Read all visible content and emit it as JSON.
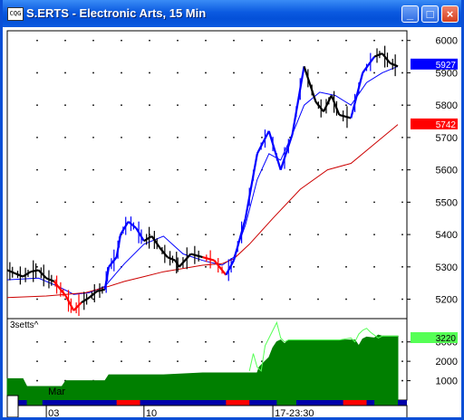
{
  "window": {
    "icon_label": "CQG",
    "title": "S.ERTS - Electronic Arts, 15 Min",
    "buttons": {
      "minimize": "_",
      "maximize": "□",
      "close": "×"
    }
  },
  "colors": {
    "price_up": "#0000ff",
    "price_down": "#ff0000",
    "price_neutral": "#000000",
    "fast_ma": "#0000ff",
    "slow_ma": "#cc0000",
    "volume_fill": "#007f00",
    "volume_line": "#55ff55"
  },
  "chart_data": [
    {
      "type": "line",
      "panel": "price",
      "title": "S.ERTS - Electronic Arts, 15 Min",
      "ylim": [
        5140,
        6030
      ],
      "y_ticks": [
        "5200",
        "5300",
        "5400",
        "5500",
        "5600",
        "5700",
        "5800",
        "5900",
        "6000"
      ],
      "x_tick_labels": [
        "03",
        "10",
        "17-23:30"
      ],
      "markers": [
        {
          "label": "5927",
          "value": 5927,
          "color": "#0000ff"
        },
        {
          "label": "5742",
          "value": 5742,
          "color": "#ff0000"
        }
      ],
      "series": [
        {
          "role": "price",
          "x": [
            0,
            2,
            4,
            6,
            8,
            10,
            12,
            13,
            15,
            17,
            19,
            21,
            23,
            25,
            26,
            28,
            29,
            31,
            33,
            35,
            37,
            39,
            41,
            43,
            44,
            47,
            50,
            53,
            56,
            58,
            61,
            64,
            67,
            70,
            73,
            76,
            79,
            81,
            83,
            85,
            88,
            91,
            94,
            96,
            98,
            100
          ],
          "values": [
            5290,
            5280,
            5270,
            5285,
            5290,
            5265,
            5255,
            5240,
            5210,
            5165,
            5190,
            5205,
            5225,
            5230,
            5300,
            5330,
            5400,
            5440,
            5420,
            5380,
            5395,
            5360,
            5330,
            5320,
            5300,
            5340,
            5330,
            5320,
            5275,
            5320,
            5450,
            5650,
            5720,
            5600,
            5710,
            5920,
            5810,
            5780,
            5830,
            5770,
            5760,
            5900,
            5950,
            5960,
            5930,
            5920
          ],
          "up_ranges": [
            [
              25,
              34
            ],
            [
              56,
              76
            ],
            [
              87,
              94
            ]
          ],
          "down_ranges": [
            [
              12,
              19
            ],
            [
              51,
              56
            ]
          ]
        },
        {
          "role": "fast_ma",
          "x": [
            0,
            8,
            13,
            17,
            21,
            25,
            30,
            35,
            40,
            45,
            50,
            55,
            58,
            61,
            64,
            67,
            70,
            73,
            76,
            80,
            84,
            88,
            92,
            96,
            100
          ],
          "values": [
            5260,
            5265,
            5240,
            5215,
            5220,
            5240,
            5310,
            5370,
            5395,
            5340,
            5320,
            5305,
            5330,
            5430,
            5570,
            5650,
            5630,
            5710,
            5800,
            5840,
            5830,
            5800,
            5870,
            5900,
            5920
          ]
        },
        {
          "role": "slow_ma",
          "x": [
            0,
            10,
            15,
            20,
            26,
            30,
            35,
            40,
            45,
            50,
            55,
            58,
            62,
            68,
            75,
            82,
            88,
            94,
            100
          ],
          "values": [
            5205,
            5210,
            5215,
            5220,
            5240,
            5255,
            5270,
            5285,
            5295,
            5305,
            5310,
            5325,
            5370,
            5450,
            5540,
            5600,
            5620,
            5680,
            5740
          ]
        }
      ]
    },
    {
      "type": "area",
      "panel": "volume",
      "title": "3setts^",
      "ylim": [
        0,
        4200
      ],
      "y_ticks": [
        "1000",
        "2000",
        "3000"
      ],
      "markers": [
        {
          "label": "3220",
          "value": 3220,
          "color": "#55ff55"
        }
      ],
      "x_tick_labels": [
        "Mar",
        "03",
        "10",
        "17-23:30"
      ],
      "series": [
        {
          "role": "volume",
          "x": [
            0,
            4,
            5,
            7,
            9,
            10,
            11,
            12,
            13,
            14,
            15,
            16,
            17,
            18,
            19,
            20,
            22,
            23,
            24,
            25,
            26,
            40,
            50,
            62,
            64,
            64.5,
            65,
            66,
            67,
            68,
            69,
            70,
            71,
            72,
            73,
            74,
            75,
            76,
            77,
            78,
            80,
            85,
            88,
            89,
            90,
            91,
            92,
            94,
            95,
            96,
            97,
            98,
            100
          ],
          "values": [
            1100,
            1100,
            700,
            700,
            700,
            700,
            700,
            700,
            700,
            700,
            1000,
            1000,
            1000,
            1000,
            1000,
            1000,
            1000,
            1000,
            1000,
            1000,
            1300,
            1300,
            1400,
            1400,
            1400,
            1700,
            1800,
            2000,
            2200,
            2700,
            3000,
            3100,
            2900,
            3100,
            3100,
            3100,
            3100,
            3100,
            3100,
            3100,
            3100,
            3100,
            3100,
            3100,
            2800,
            3150,
            3250,
            3200,
            3350,
            3300,
            3300,
            3300,
            3300
          ]
        },
        {
          "role": "volume_signal",
          "x": [
            62,
            63,
            64,
            65,
            66,
            68,
            69,
            70,
            71,
            72,
            73,
            75,
            80,
            85,
            88,
            89,
            90,
            91,
            92,
            93,
            95,
            96,
            97,
            100
          ],
          "values": [
            1500,
            2400,
            1700,
            1500,
            2800,
            3600,
            4000,
            3200,
            3000,
            3100,
            3100,
            3100,
            3100,
            3100,
            3200,
            3000,
            3400,
            3600,
            3700,
            3500,
            3200,
            3300,
            3300,
            3300
          ]
        }
      ]
    }
  ]
}
